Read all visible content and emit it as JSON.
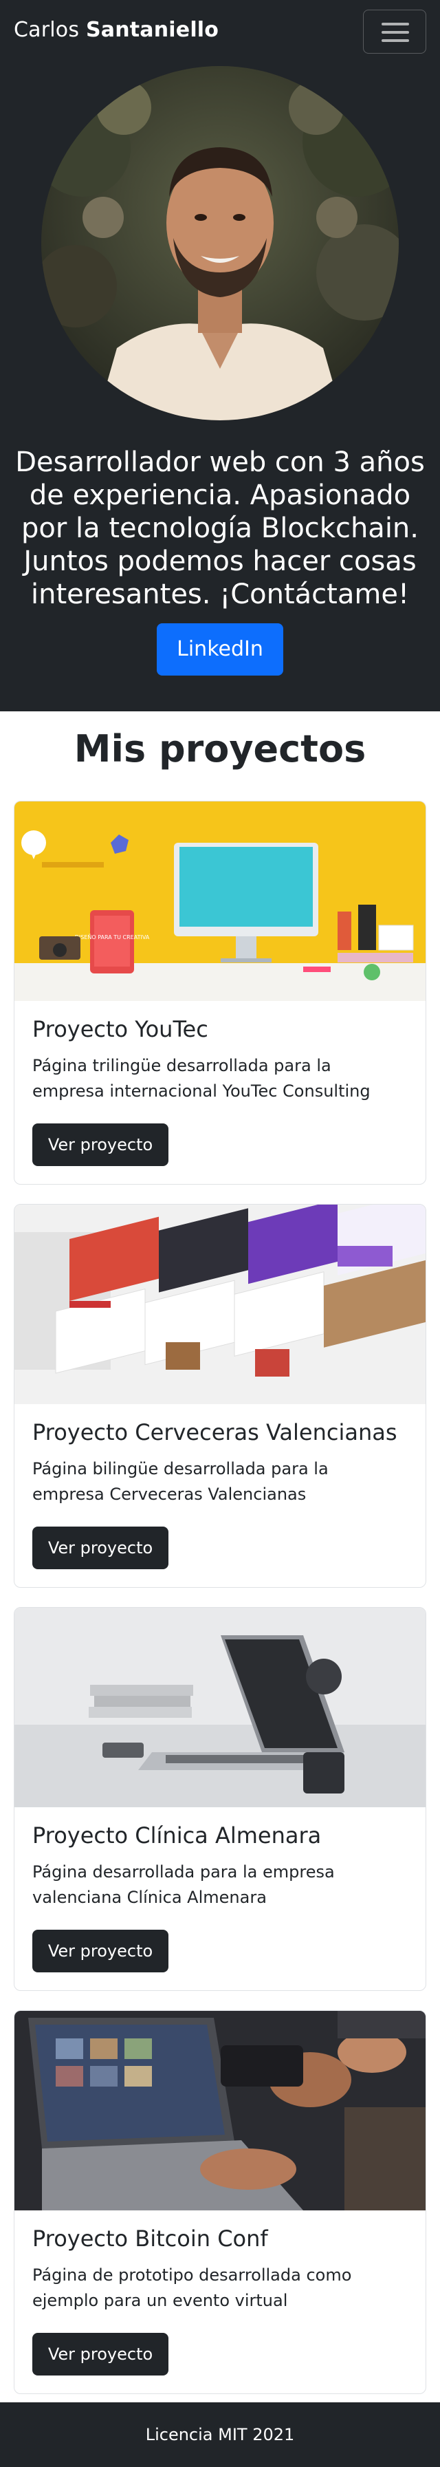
{
  "navbar": {
    "brand_first": "Carlos",
    "brand_last": "Santaniello",
    "menu_icon": "hamburger-menu-icon"
  },
  "hero": {
    "photo": "profile-photo",
    "text": "Desarrollador web con 3 años de experiencia. Apasionado por la tecnología Blockchain. Juntos podemos hacer cosas interesantes. ¡Contáctame!",
    "button_label": "LinkedIn"
  },
  "projects": {
    "title": "Mis proyectos",
    "items": [
      {
        "title": "Proyecto YouTec",
        "description": "Página trilingüe desarrollada para la empresa internacional YouTec Consulting",
        "button_label": "Ver proyecto",
        "screen_text": "DISEÑO PARA TU CREATIVA"
      },
      {
        "title": "Proyecto Cerveceras Valencianas",
        "description": "Página bilingüe desarrollada para la empresa Cerveceras Valencianas",
        "button_label": "Ver proyecto"
      },
      {
        "title": "Proyecto Clínica Almenara",
        "description": "Página desarrollada para la empresa valenciana Clínica Almenara",
        "button_label": "Ver proyecto"
      },
      {
        "title": "Proyecto Bitcoin Conf",
        "description": "Página de prototipo desarrollada como ejemplo para un evento virtual",
        "button_label": "Ver proyecto"
      }
    ]
  },
  "footer": {
    "text": "Licencia MIT 2021"
  },
  "colors": {
    "dark": "#212529",
    "primary": "#0d6efd"
  }
}
